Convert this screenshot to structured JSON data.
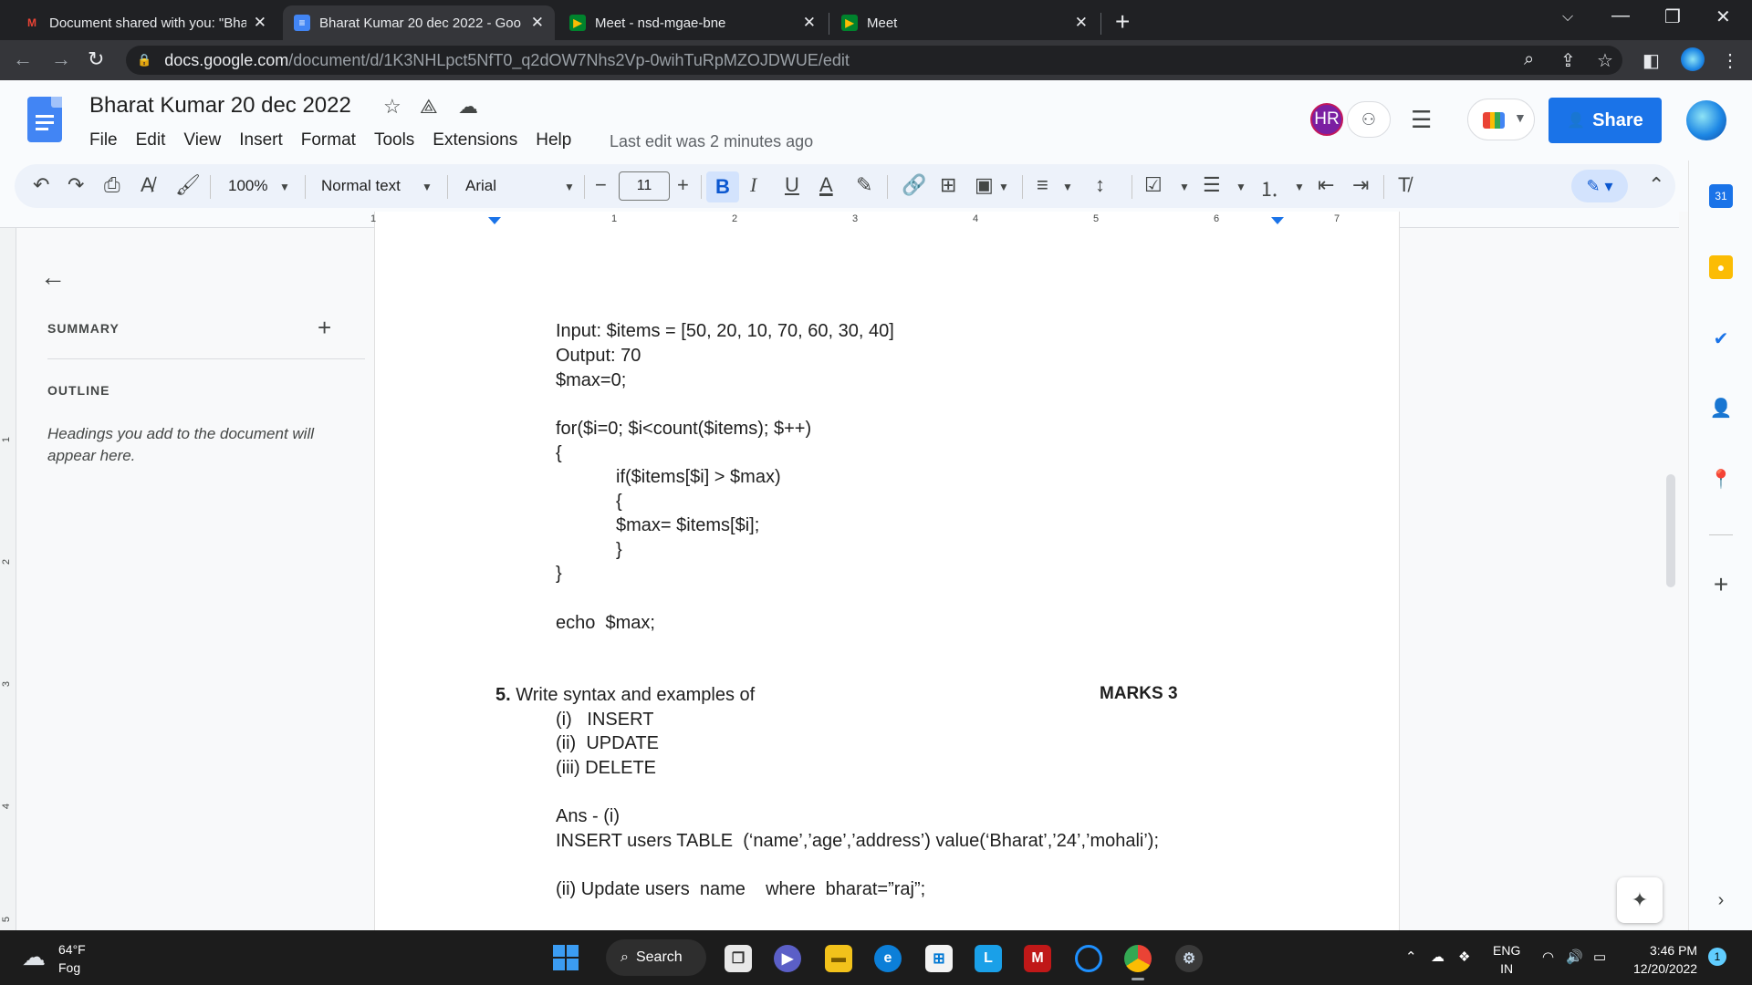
{
  "browser": {
    "tabs": [
      {
        "title": "Document shared with you: \"Bha",
        "favicon": "gmail-icon"
      },
      {
        "title": "Bharat Kumar 20 dec 2022 - Goo",
        "favicon": "docs-icon"
      },
      {
        "title": "Meet - nsd-mgae-bne",
        "favicon": "meet-icon"
      },
      {
        "title": "Meet",
        "favicon": "meet-icon"
      }
    ],
    "url_host": "docs.google.com",
    "url_path": "/document/d/1K3NHLpct5NfT0_q2dOW7Nhs2Vp-0wihTuRpMZOJDWUE/edit"
  },
  "doc": {
    "title": "Bharat Kumar 20 dec 2022",
    "menu": [
      "File",
      "Edit",
      "View",
      "Insert",
      "Format",
      "Tools",
      "Extensions",
      "Help"
    ],
    "last_edit": "Last edit was 2 minutes ago",
    "collaborator_initials": "HR",
    "share_label": "Share"
  },
  "toolbar": {
    "zoom": "100%",
    "style": "Normal text",
    "font": "Arial",
    "font_size": "11",
    "bold": "B",
    "italic": "I",
    "underline": "U",
    "text_color": "A"
  },
  "ruler": {
    "numbers": [
      "1",
      "1",
      "2",
      "3",
      "4",
      "5",
      "6",
      "7"
    ],
    "vertical_numbers": [
      "1",
      "2",
      "3",
      "4",
      "5"
    ]
  },
  "sidebar": {
    "summary_label": "SUMMARY",
    "outline_label": "OUTLINE",
    "hint": "Headings you add to the document will appear here."
  },
  "content": {
    "lines": [
      "Input: $items = [50, 20, 10, 70, 60, 30, 40]",
      "Output: 70",
      "$max=0;",
      "for($i=0; $i<count($items); $++)",
      "{",
      "if($items[$i] > $max)",
      "{",
      "$max= $items[$i];",
      "}",
      "}",
      "echo  $max;"
    ],
    "question_number": "5.",
    "question_text": "Write syntax and examples of",
    "marks": "MARKS 3",
    "options": [
      "(i)   INSERT",
      "(ii)  UPDATE",
      "(iii) DELETE"
    ],
    "answer_lines": [
      "Ans - (i)",
      "INSERT users TABLE  (‘name’,’age’,’address’) value(‘Bharat’,’24’,’mohali’);",
      "(ii) Update users  name    where  bharat=”raj”;"
    ]
  },
  "taskbar": {
    "temperature": "64°F",
    "condition": "Fog",
    "search_label": "Search",
    "lang_line1": "ENG",
    "lang_line2": "IN",
    "time": "3:46 PM",
    "date": "12/20/2022",
    "notification_count": "1"
  },
  "colors": {
    "share_button": "#1a73e8",
    "docs_blue": "#4285f4",
    "tab_bar": "#202124",
    "taskbar": "#1c1c1c"
  }
}
